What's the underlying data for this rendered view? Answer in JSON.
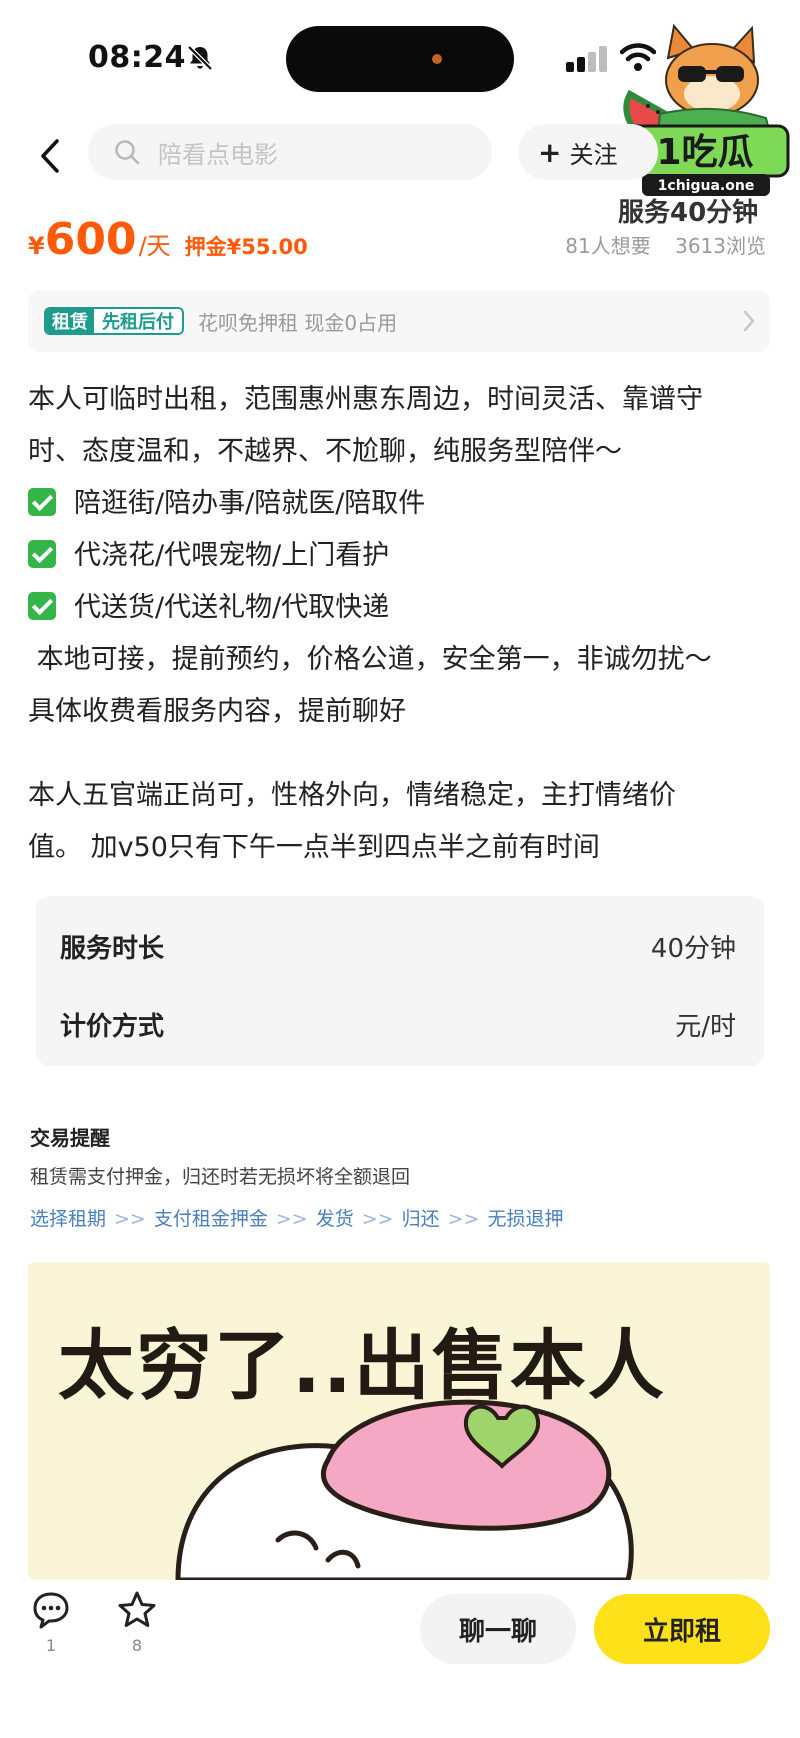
{
  "status_bar": {
    "time": "08:24"
  },
  "watermark": {
    "brand": "1吃瓜",
    "domain": "1chigua.one"
  },
  "nav": {
    "search_placeholder": "陪看点电影",
    "follow_label": "关注",
    "service_title": "服务40分钟"
  },
  "price": {
    "currency": "¥",
    "amount": "600",
    "unit": "/天",
    "deposit": "押金¥55.00",
    "wants": "81人想要",
    "views": "3613浏览"
  },
  "credit_banner": {
    "badge_left": "租赁",
    "badge_right": "先租后付",
    "text": "花呗免押租 现金0占用"
  },
  "description": {
    "intro_line1": "本人可临时出租，范围惠州惠东周边，时间灵活、靠谱守",
    "intro_line2": "时、态度温和，不越界、不尬聊，纯服务型陪伴～",
    "check_items": [
      "陪逛街/陪办事/陪就医/陪取件",
      "代浇花/代喂宠物/上门看护",
      "代送货/代送礼物/代取快递"
    ],
    "line_local": " 本地可接，提前预约，价格公道，安全第一，非诚勿扰～",
    "line_fee": "具体收费看服务内容，提前聊好",
    "self_line1": "本人五官端正尚可，性格外向，情绪稳定，主打情绪价",
    "self_line2": "值。 加v50只有下午一点半到四点半之前有时间"
  },
  "spec": {
    "rows": [
      {
        "key": "服务时长",
        "value": "40分钟"
      },
      {
        "key": "计价方式",
        "value": "元/时"
      }
    ]
  },
  "notice": {
    "title": "交易提醒",
    "desc": "租赁需支付押金，归还时若无损坏将全额退回",
    "steps": [
      "选择租期",
      "支付租金押金",
      "发货",
      "归还",
      "无损退押"
    ],
    "sep": ">>"
  },
  "image_card": {
    "title": "太穷了..出售本人"
  },
  "bottom_bar": {
    "comment_count": "1",
    "fav_count": "8",
    "chat_label": "聊一聊",
    "rent_label": "立即租"
  },
  "colors": {
    "price_orange": "#ff5a0a",
    "rent_yellow": "#ffe11a",
    "badge_teal": "#1d9c8d",
    "link_blue": "#4a7fbf",
    "check_green": "#35b44a"
  },
  "icons": [
    "bell-off-icon",
    "signal-icon",
    "wifi-icon",
    "back-chevron-icon",
    "search-icon",
    "chevron-right-icon",
    "check-icon",
    "comment-icon",
    "star-icon"
  ]
}
